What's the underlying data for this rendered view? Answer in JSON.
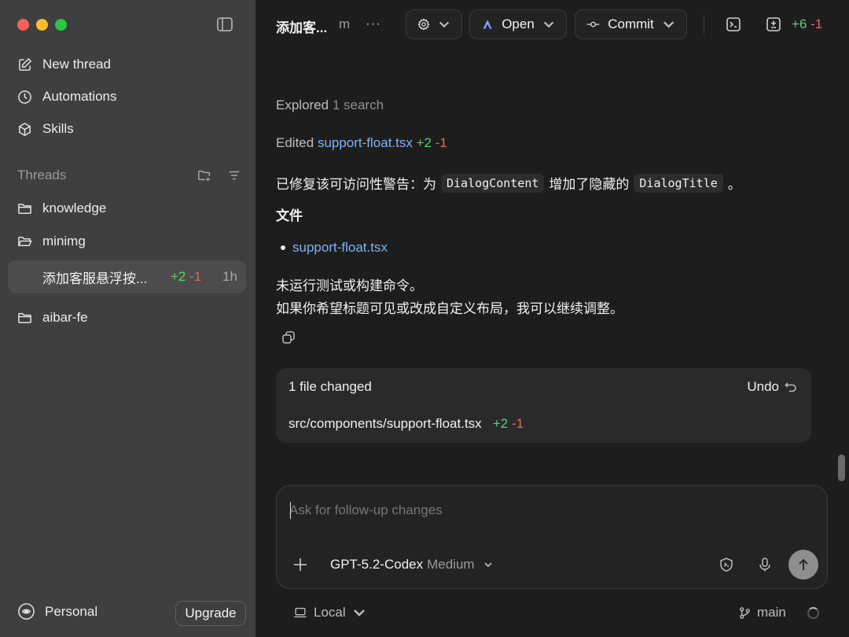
{
  "sidebar": {
    "nav": [
      {
        "label": "New thread",
        "icon": "edit-icon"
      },
      {
        "label": "Automations",
        "icon": "clock-icon"
      },
      {
        "label": "Skills",
        "icon": "cube-icon"
      }
    ],
    "threads_header": "Threads",
    "folders": [
      {
        "label": "knowledge"
      },
      {
        "label": "minimg"
      },
      {
        "label": "aibar-fe"
      }
    ],
    "active_thread": {
      "title": "添加客服悬浮按...",
      "added": "+2",
      "removed": "-1",
      "time": "1h"
    },
    "account": {
      "label": "Personal",
      "upgrade": "Upgrade"
    }
  },
  "header": {
    "title": "添加客...",
    "subtitle": "m",
    "more": "···",
    "open_label": "Open",
    "commit_label": "Commit",
    "added": "+6",
    "removed": "-1"
  },
  "conversation": {
    "explored_label": "Explored",
    "explored_detail": "1 search",
    "edited_label": "Edited",
    "edited_file": "support-float.tsx",
    "edited_added": "+2",
    "edited_removed": "-1",
    "msg_part1": "已修复该可访问性警告：为",
    "code1": "DialogContent",
    "msg_part2": "增加了隐藏的",
    "code2": "DialogTitle",
    "msg_part3": "。",
    "files_heading": "文件",
    "file_link": "support-float.tsx",
    "line1": "未运行测试或构建命令。",
    "line2": "如果你希望标题可见或改成自定义布局，我可以继续调整。"
  },
  "changes": {
    "title": "1 file changed",
    "undo": "Undo",
    "file_path": "src/components/support-float.tsx",
    "added": "+2",
    "removed": "-1"
  },
  "composer": {
    "placeholder": "Ask for follow-up changes",
    "model": "GPT-5.2-Codex",
    "effort": "Medium"
  },
  "footer": {
    "env": "Local",
    "branch": "main"
  },
  "colors": {
    "added": "#5fcf6f",
    "removed": "#f0625a",
    "link": "#7fb2f0"
  }
}
